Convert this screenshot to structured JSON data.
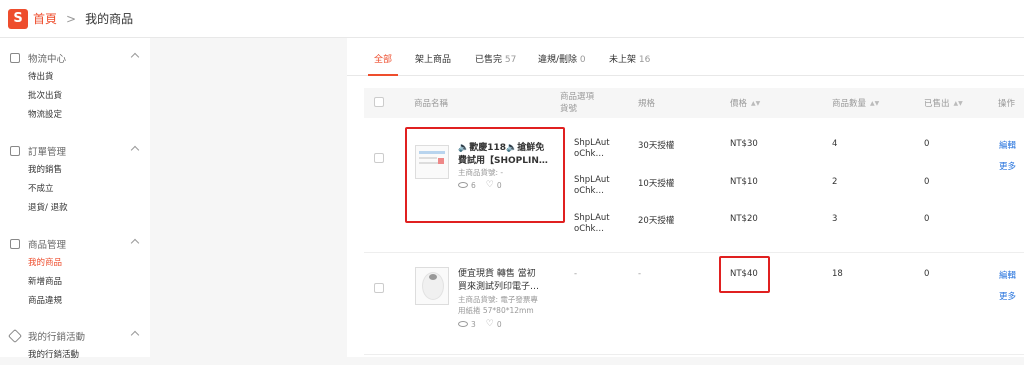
{
  "header": {
    "logo": "S",
    "home": "首頁",
    "separator": ">",
    "current": "我的商品"
  },
  "sidebar": {
    "groups": [
      {
        "title": "物流中心",
        "icon": "shipping-icon",
        "items": [
          "待出貨",
          "批次出貨",
          "物流設定"
        ]
      },
      {
        "title": "訂單管理",
        "icon": "order-icon",
        "items": [
          "我的銷售",
          "不成立",
          "退貨/ 退款"
        ]
      },
      {
        "title": "商品管理",
        "icon": "product-icon",
        "items": [
          "我的商品",
          "新增商品",
          "商品違規"
        ],
        "active": "我的商品"
      },
      {
        "title": "我的行銷活動",
        "icon": "marketing-icon",
        "items": [
          "我的行銷活動"
        ]
      }
    ]
  },
  "tabs": [
    {
      "label": "全部",
      "count": ""
    },
    {
      "label": "架上商品",
      "count": ""
    },
    {
      "label": "已售完",
      "count": "57"
    },
    {
      "label": "違規/刪除",
      "count": "0"
    },
    {
      "label": "未上架",
      "count": "16"
    }
  ],
  "table": {
    "headers": {
      "name": "商品名稱",
      "variant_sku_l1": "商品選項",
      "variant_sku_l2": "貨號",
      "spec": "規格",
      "price": "價格",
      "stock": "商品數量",
      "sold": "已售出",
      "actions": "操作"
    },
    "rows": [
      {
        "name": "🔈歡慶118🔈搶鮮免費試用【SHOPLIN…",
        "name_l1": "🔈歡慶118🔈搶鮮免",
        "name_l2": "費試用【SHOPLIN…",
        "parent_sku": "主商品貨號: -",
        "views": "6",
        "likes": "0",
        "variants": [
          {
            "sku_l1": "ShpLAut",
            "sku_l2": "oChk…",
            "spec": "30天授權",
            "price": "NT$30",
            "stock": "4",
            "sold": "0"
          },
          {
            "sku_l1": "ShpLAut",
            "sku_l2": "oChk…",
            "spec": "10天授權",
            "price": "NT$10",
            "stock": "2",
            "sold": "0"
          },
          {
            "sku_l1": "ShpLAut",
            "sku_l2": "oChk…",
            "spec": "20天授權",
            "price": "NT$20",
            "stock": "3",
            "sold": "0"
          }
        ],
        "edit": "編輯",
        "more": "更多"
      },
      {
        "name_l1": "便宜現貨 轉售 當初",
        "name_l2": "買來測試列印電子…",
        "parent_sku_l1": "主商品貨號: 電子發票專",
        "parent_sku_l2": "用紙捲 57*80*12mm",
        "views": "3",
        "likes": "0",
        "sku": "-",
        "spec": "-",
        "price": "NT$40",
        "stock": "18",
        "sold": "0",
        "edit": "編輯",
        "more": "更多"
      }
    ]
  },
  "colors": {
    "accent": "#ee4d2d",
    "link": "#2673dd",
    "highlight": "#e02020"
  }
}
